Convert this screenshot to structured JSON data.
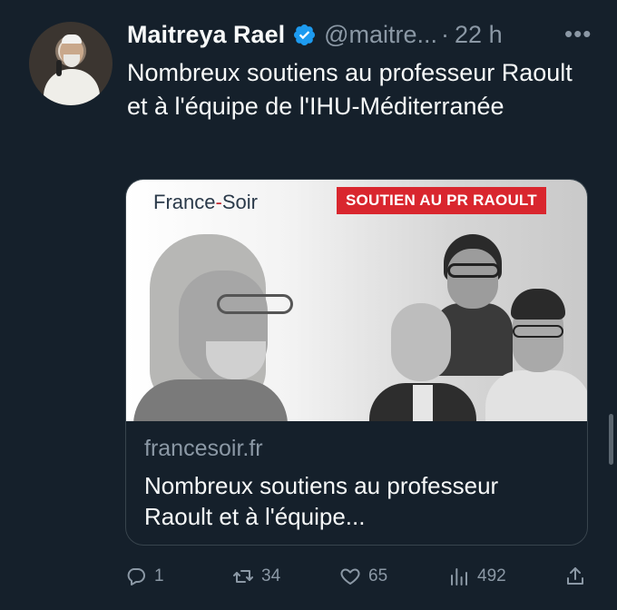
{
  "tweet": {
    "author_name": "Maitreya Rael",
    "handle": "@maitre...",
    "separator": "·",
    "time": "22 h",
    "more_label": "•••",
    "text": "Nombreux soutiens au professeur Raoult et à l'équipe de l'IHU-Méditerranée"
  },
  "card": {
    "image": {
      "logo_part1": "France",
      "logo_dash": "-",
      "logo_part2": "Soir",
      "banner": "SOUTIEN AU PR RAOULT"
    },
    "domain": "francesoir.fr",
    "title": "Nombreux soutiens au professeur Raoult et à l'équipe..."
  },
  "actions": {
    "reply_count": "1",
    "retweet_count": "34",
    "like_count": "65",
    "view_count": "492"
  },
  "colors": {
    "background": "#15202b",
    "text_primary": "#f7f9f9",
    "text_secondary": "#8b98a5",
    "verified": "#1d9bf0",
    "banner_red": "#d9262e"
  },
  "icons": [
    "verified-icon",
    "more-icon",
    "reply-icon",
    "retweet-icon",
    "like-icon",
    "views-icon",
    "share-icon"
  ]
}
